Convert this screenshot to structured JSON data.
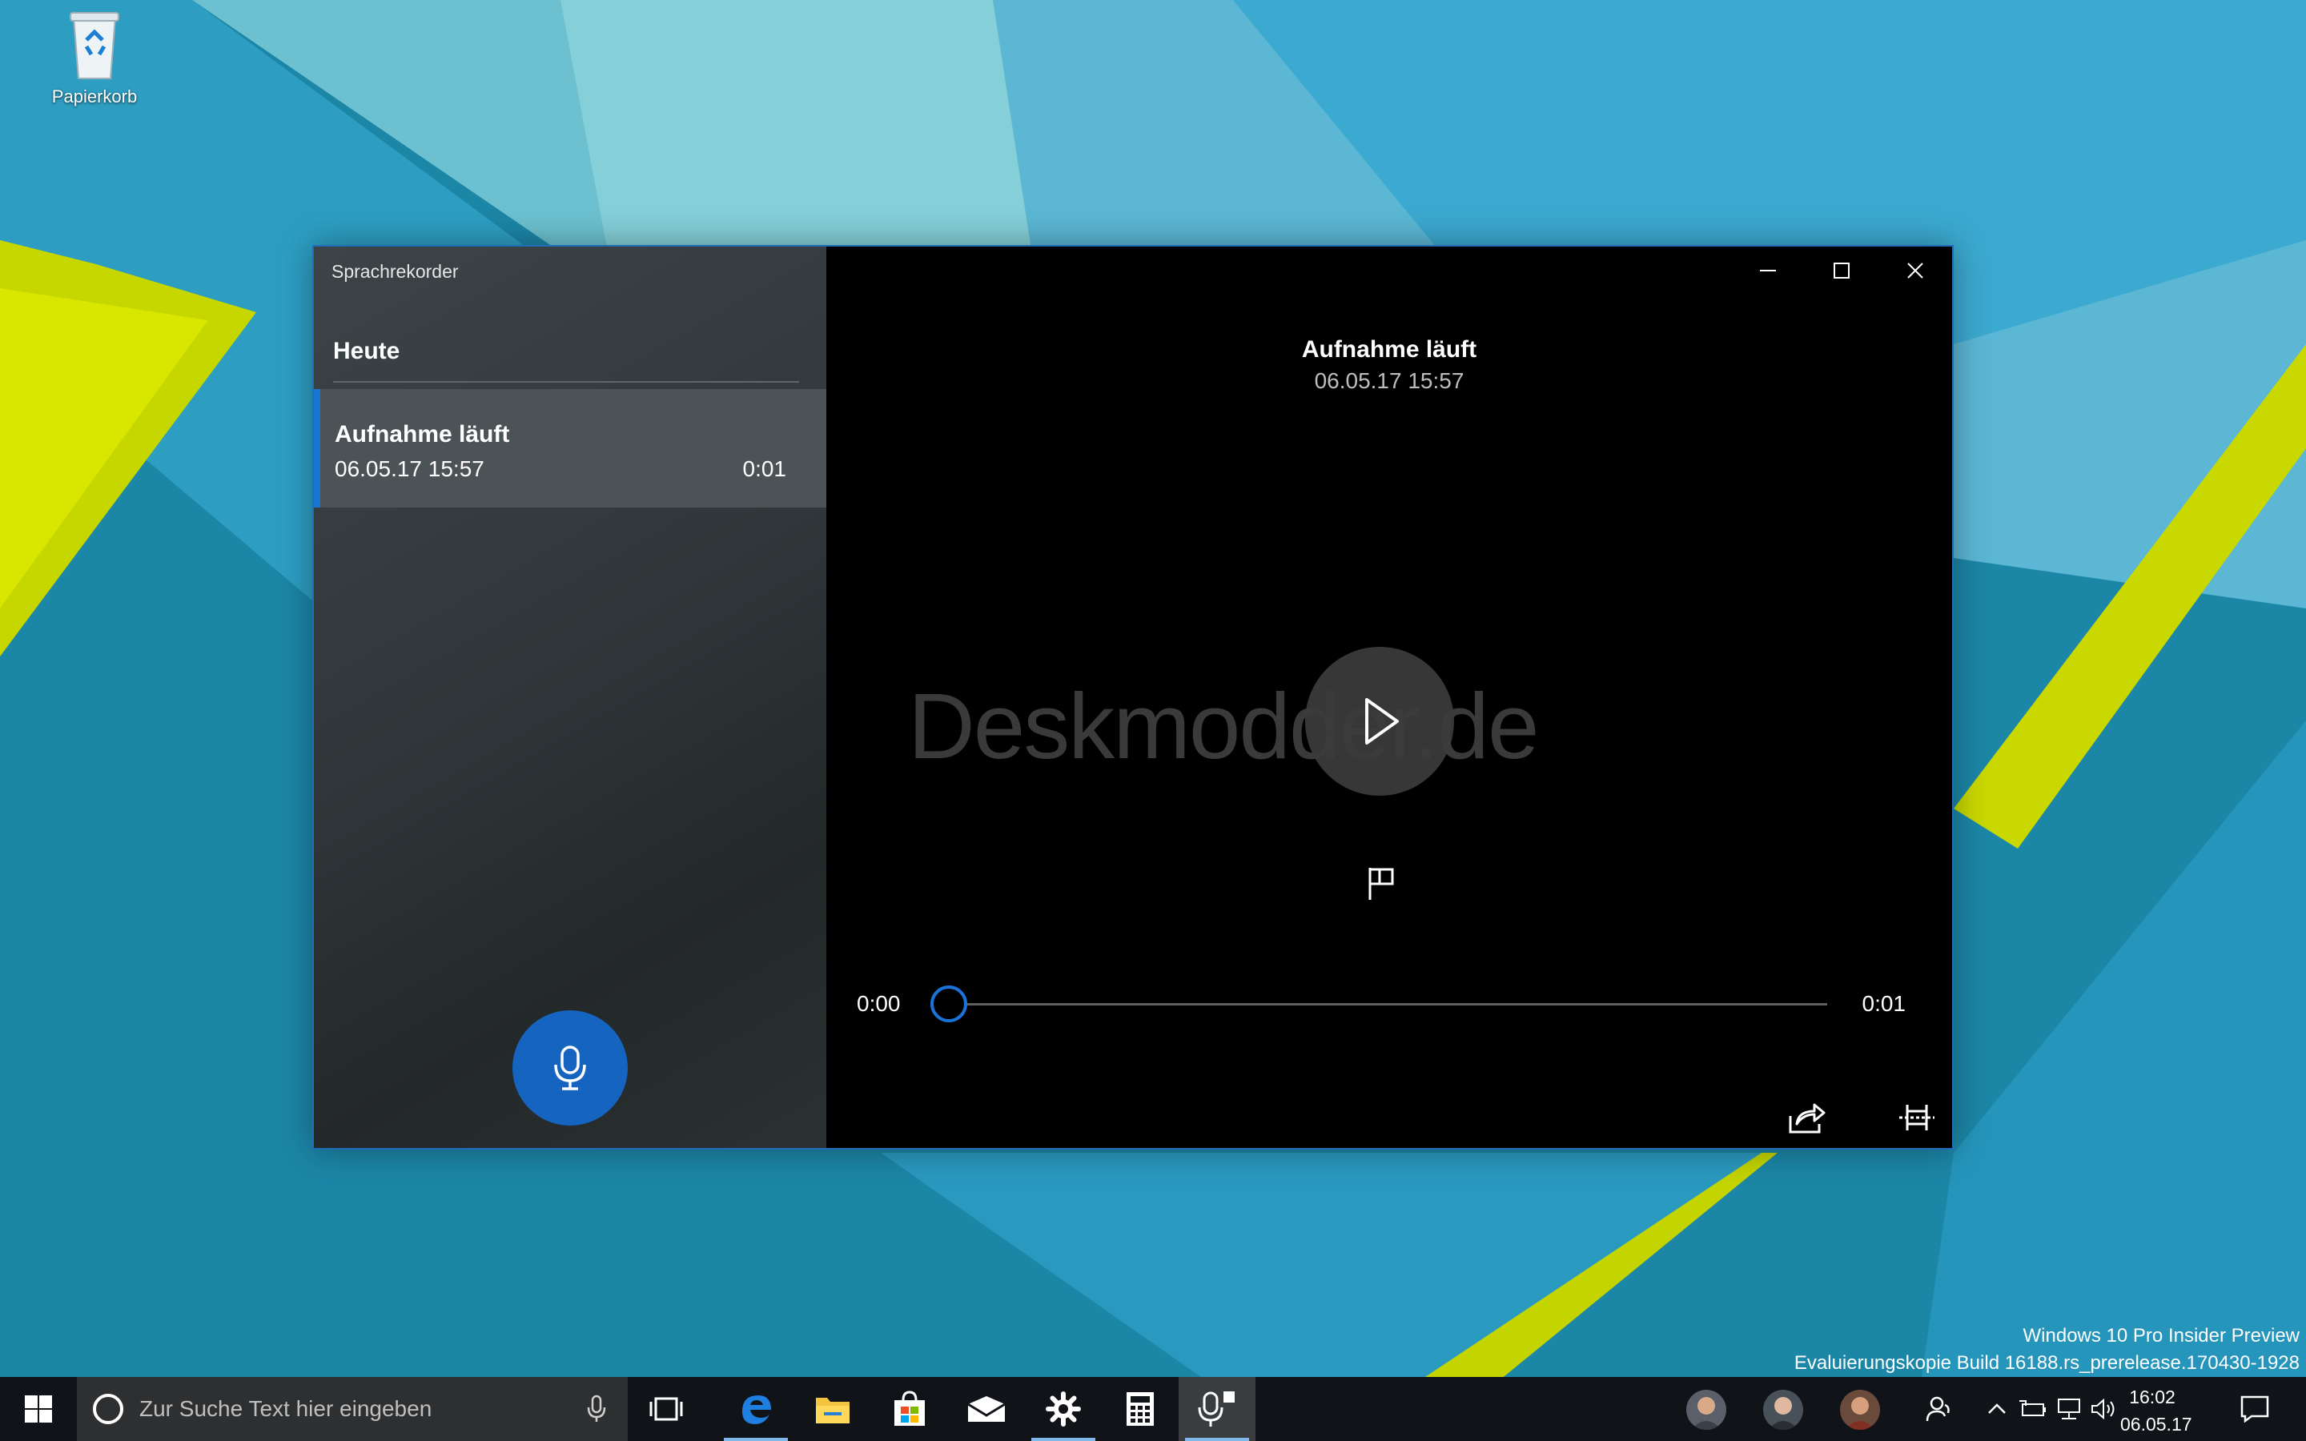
{
  "desktop": {
    "recycle_bin_label": "Papierkorb"
  },
  "window": {
    "app_title": "Sprachrekorder",
    "group_heading": "Heute",
    "recording": {
      "title": "Aufnahme läuft",
      "date": "06.05.17 15:57",
      "duration": "0:01"
    },
    "detail": {
      "title": "Aufnahme läuft",
      "date": "06.05.17 15:57",
      "watermark": "Deskmodder.de",
      "time_current": "0:00",
      "time_total": "0:01",
      "progress": 0
    },
    "controls": {
      "icons": [
        "minimize-icon",
        "maximize-icon",
        "close-icon",
        "play-icon",
        "flag-icon",
        "microphone-icon",
        "share-icon",
        "trim-icon",
        "delete-icon",
        "rename-icon",
        "more-icon"
      ]
    },
    "accent_color": "#1565c0"
  },
  "system": {
    "watermark_line1": "Windows 10 Pro Insider Preview",
    "watermark_line2": "Evaluierungskopie Build 16188.rs_prerelease.170430-1928"
  },
  "taskbar": {
    "search_placeholder": "Zur Suche Text hier eingeben",
    "clock_time": "16:02",
    "clock_date": "06.05.17",
    "pinned_icons": [
      "windows-icon",
      "cortana-icon",
      "task-view-icon",
      "edge-icon",
      "file-explorer-icon",
      "store-icon",
      "mail-icon",
      "settings-icon",
      "calculator-icon",
      "voice-recorder-icon"
    ]
  }
}
